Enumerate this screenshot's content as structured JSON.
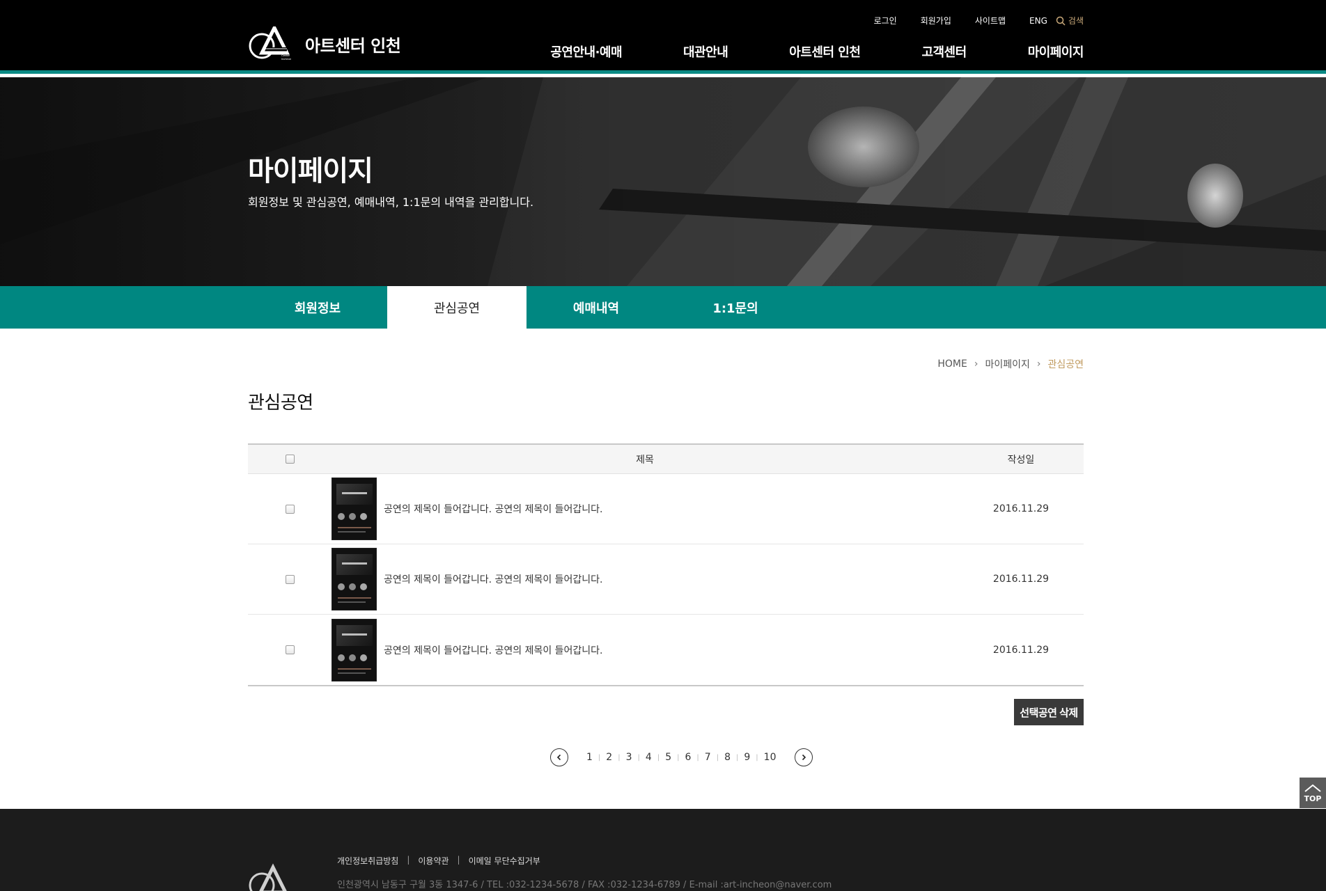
{
  "header": {
    "util": [
      "로그인",
      "회원가입",
      "사이트맵",
      "ENG"
    ],
    "search_label": "검색",
    "logo_text": "아트센터 인천",
    "logo_small": [
      "Arts",
      "Center",
      "Incheon"
    ],
    "gnb": [
      "공연안내·예매",
      "대관안내",
      "아트센터 인천",
      "고객센터",
      "마이페이지"
    ]
  },
  "hero": {
    "title": "마이페이지",
    "desc": "회원정보 및 관심공연, 예매내역, 1:1문의 내역을 관리합니다."
  },
  "tabs": [
    "회원정보",
    "관심공연",
    "예매내역",
    "1:1문의"
  ],
  "active_tab": 1,
  "breadcrumb": {
    "home": "HOME",
    "level1": "마이페이지",
    "current": "관심공연"
  },
  "page_title": "관심공연",
  "table": {
    "headers": {
      "title": "제목",
      "date": "작성일"
    },
    "rows": [
      {
        "title": "공연의 제목이 들어갑니다. 공연의 제목이 들어갑니다.",
        "date": "2016.11.29"
      },
      {
        "title": "공연의 제목이 들어갑니다. 공연의 제목이 들어갑니다.",
        "date": "2016.11.29"
      },
      {
        "title": "공연의 제목이 들어갑니다. 공연의 제목이 들어갑니다.",
        "date": "2016.11.29"
      }
    ]
  },
  "delete_button": "선택공연 삭제",
  "pagination": [
    "1",
    "2",
    "3",
    "4",
    "5",
    "6",
    "7",
    "8",
    "9",
    "10"
  ],
  "top_button": "TOP",
  "footer": {
    "links": [
      "개인정보취급방침",
      "이용약관",
      "이메일 무단수집거부"
    ],
    "address": "인천광역시 남동구 구월 3동 1347-6 / TEL :032-1234-5678 / FAX :032-1234-6789 / E-mail :art-incheon@naver.com"
  },
  "colors": {
    "accent": "#008781",
    "gold": "#c09a5e",
    "dark": "#000000"
  },
  "icons": {
    "search": "search-icon",
    "prev": "chevron-left-icon",
    "next": "chevron-right-icon",
    "top": "chevron-up-icon"
  }
}
